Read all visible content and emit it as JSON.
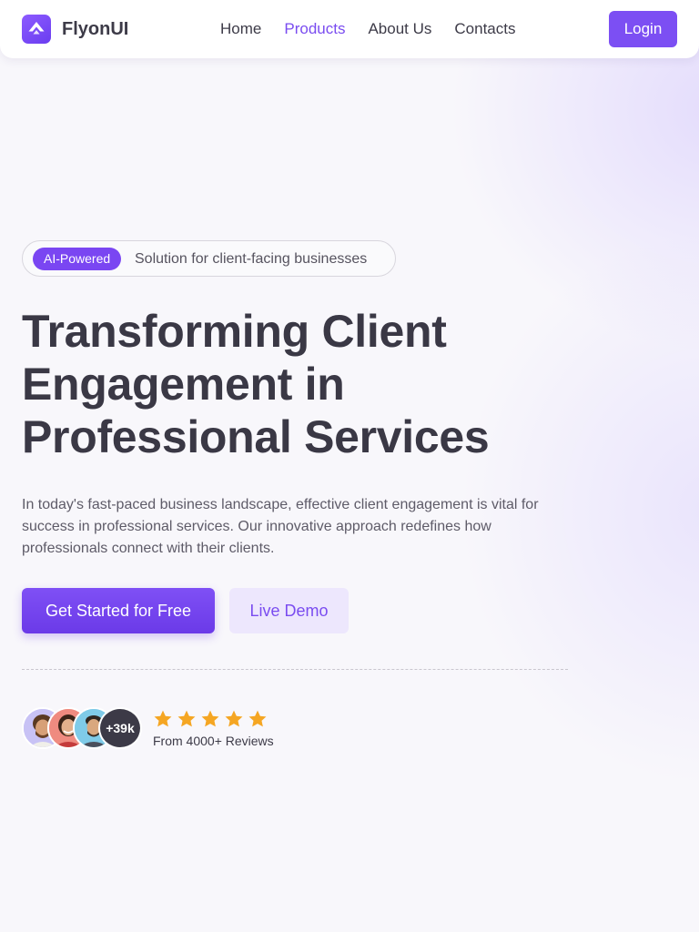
{
  "brand": {
    "name": "FlyonUI",
    "logo_icon": "flyonui-logo-icon"
  },
  "nav": {
    "links": [
      {
        "label": "Home",
        "active": false
      },
      {
        "label": "Products",
        "active": true
      },
      {
        "label": "About Us",
        "active": false
      },
      {
        "label": "Contacts",
        "active": false
      }
    ],
    "login_label": "Login"
  },
  "hero": {
    "badge_label": "AI-Powered",
    "badge_text": "Solution for client-facing businesses",
    "title_lines": [
      "Transforming Client",
      "Engagement in",
      "Professional Services"
    ],
    "description": "In today's fast-paced business landscape, effective client engagement is vital for success in professional services. Our innovative approach redefines how professionals connect with their clients.",
    "cta_primary": "Get Started for Free",
    "cta_secondary": "Live Demo"
  },
  "social_proof": {
    "avatar_count_label": "+39k",
    "rating": 5,
    "rating_max": 5,
    "reviews_text": "From 4000+ Reviews"
  },
  "colors": {
    "accent": "#7c4ff3",
    "accent_light": "#ede7fd",
    "star": "#f5a623",
    "text_dark": "#3a3845"
  }
}
